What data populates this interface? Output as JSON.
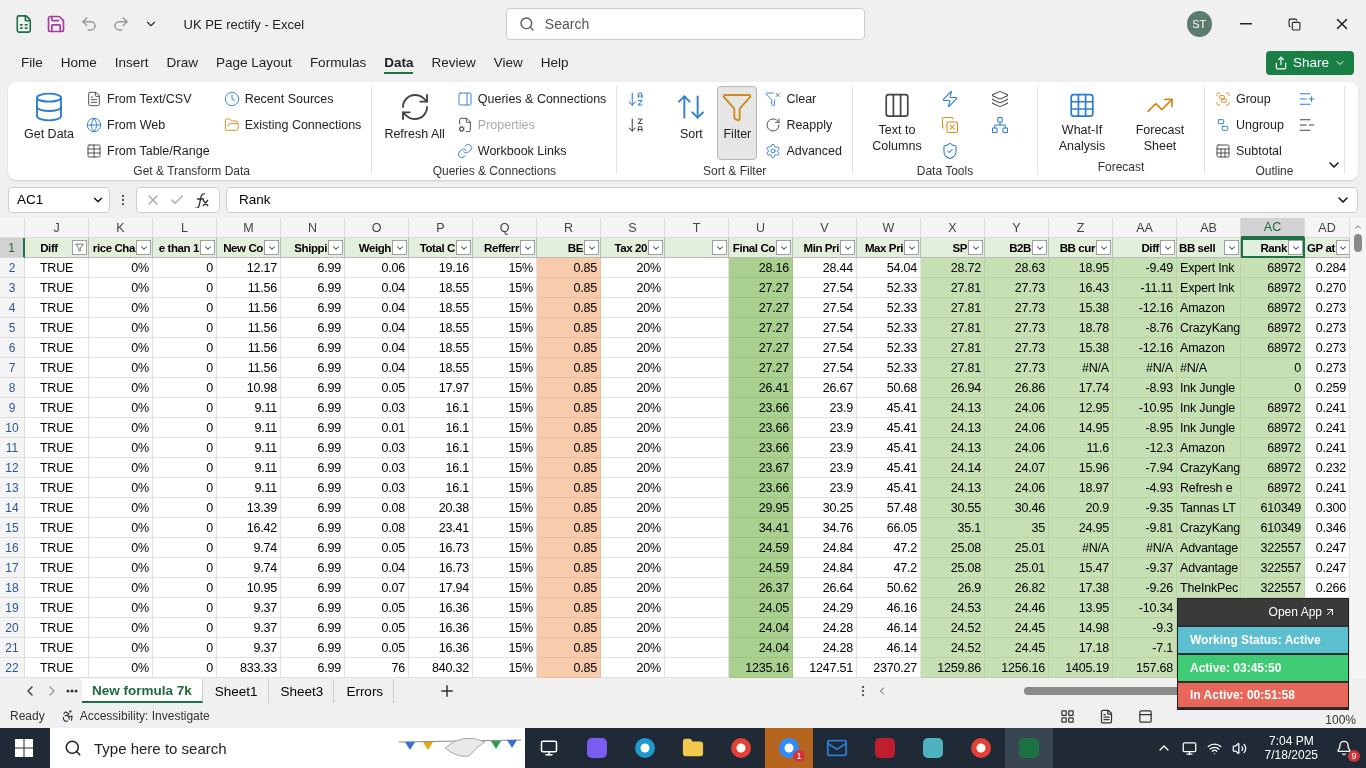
{
  "title_bar": {
    "title": "UK PE rectify  -  Excel",
    "search_placeholder": "Search",
    "avatar": "ST"
  },
  "menu_tabs": [
    {
      "label": "File",
      "selected": false
    },
    {
      "label": "Home",
      "selected": false
    },
    {
      "label": "Insert",
      "selected": false
    },
    {
      "label": "Draw",
      "selected": false
    },
    {
      "label": "Page Layout",
      "selected": false
    },
    {
      "label": "Formulas",
      "selected": false
    },
    {
      "label": "Data",
      "selected": true
    },
    {
      "label": "Review",
      "selected": false
    },
    {
      "label": "View",
      "selected": false
    },
    {
      "label": "Help",
      "selected": false
    }
  ],
  "share_button": "Share",
  "ribbon": [
    {
      "label": "Get & Transform Data",
      "items": [
        {
          "kind": "large",
          "label": "Get Data"
        },
        {
          "kind": "small",
          "label": "From Text/CSV"
        },
        {
          "kind": "small",
          "label": "From Web"
        },
        {
          "kind": "small",
          "label": "From Table/Range"
        },
        {
          "kind": "small",
          "label": "Recent Sources"
        },
        {
          "kind": "small",
          "label": "Existing Connections"
        }
      ]
    },
    {
      "label": "Queries & Connections",
      "items": [
        {
          "kind": "large",
          "label": "Refresh All"
        },
        {
          "kind": "small",
          "label": "Queries & Connections"
        },
        {
          "kind": "small",
          "label": "Properties",
          "disabled": true
        },
        {
          "kind": "small",
          "label": "Workbook Links"
        }
      ]
    },
    {
      "label": "Sort & Filter",
      "items": [
        {
          "kind": "icon"
        },
        {
          "kind": "icon"
        },
        {
          "kind": "large",
          "label": "Sort"
        },
        {
          "kind": "large",
          "label": "Filter",
          "pressed": true
        },
        {
          "kind": "small",
          "label": "Clear"
        },
        {
          "kind": "small",
          "label": "Reapply"
        },
        {
          "kind": "small",
          "label": "Advanced"
        }
      ]
    },
    {
      "label": "Data Tools",
      "items": [
        {
          "kind": "large",
          "label": "Text to Columns"
        },
        {
          "kind": "icon"
        },
        {
          "kind": "icon"
        },
        {
          "kind": "icon"
        },
        {
          "kind": "icon"
        },
        {
          "kind": "icon"
        }
      ]
    },
    {
      "label": "Forecast",
      "items": [
        {
          "kind": "large",
          "label": "What-If Analysis"
        },
        {
          "kind": "large",
          "label": "Forecast Sheet"
        }
      ]
    },
    {
      "label": "Outline",
      "items": [
        {
          "kind": "small",
          "label": "Group"
        },
        {
          "kind": "small",
          "label": "Ungroup"
        },
        {
          "kind": "small",
          "label": "Subtotal"
        },
        {
          "kind": "icon"
        },
        {
          "kind": "icon"
        }
      ]
    }
  ],
  "formula_bar": {
    "name_box": "AC1",
    "formula": "Rank"
  },
  "columns": [
    {
      "letter": "J",
      "header": "Diff",
      "kind": "bool",
      "filtered": true,
      "selected": false
    },
    {
      "letter": "K",
      "header": "rice Cha",
      "kind": "number",
      "filtered": false,
      "selected": false
    },
    {
      "letter": "L",
      "header": "e than 1",
      "kind": "number",
      "filtered": false,
      "selected": false
    },
    {
      "letter": "M",
      "header": "New Co",
      "kind": "number",
      "filtered": false,
      "selected": false
    },
    {
      "letter": "N",
      "header": "Shippi",
      "kind": "number",
      "filtered": false,
      "selected": false
    },
    {
      "letter": "O",
      "header": "Weigh",
      "kind": "number",
      "filtered": false,
      "selected": false
    },
    {
      "letter": "P",
      "header": "Total C",
      "kind": "number",
      "filtered": false,
      "selected": false
    },
    {
      "letter": "Q",
      "header": "Refferr",
      "kind": "number",
      "filtered": false,
      "selected": false
    },
    {
      "letter": "R",
      "header": "BE",
      "kind": "number",
      "filtered": false,
      "selected": false,
      "color": "#f8cbad"
    },
    {
      "letter": "S",
      "header": "Tax 20",
      "kind": "number",
      "filtered": false,
      "selected": false
    },
    {
      "letter": "T",
      "kind": "number",
      "filtered": false,
      "selected": false
    },
    {
      "letter": "U",
      "header": "Final Co",
      "kind": "number",
      "filtered": false,
      "selected": false,
      "color": "#a9d08e"
    },
    {
      "letter": "V",
      "header": "Min Pri",
      "kind": "number",
      "filtered": false,
      "selected": false
    },
    {
      "letter": "W",
      "header": "Max Pri",
      "kind": "number",
      "filtered": false,
      "selected": false
    },
    {
      "letter": "X",
      "header": "SP",
      "kind": "number",
      "filtered": false,
      "selected": false,
      "color": "#c6e0b4"
    },
    {
      "letter": "Y",
      "header": "B2B",
      "kind": "number",
      "filtered": false,
      "selected": false,
      "color": "#c6e0b4"
    },
    {
      "letter": "Z",
      "header": "BB cur",
      "kind": "number",
      "filtered": false,
      "selected": false,
      "color": "#c6e0b4"
    },
    {
      "letter": "AA",
      "header": "Diff",
      "kind": "number",
      "filtered": false,
      "selected": false,
      "color": "#c6e0b4"
    },
    {
      "letter": "AB",
      "header": "BB sell",
      "kind": "text",
      "filtered": false,
      "selected": false,
      "color": "#c6e0b4"
    },
    {
      "letter": "AC",
      "header": "Rank",
      "kind": "number",
      "filtered": false,
      "selected": true,
      "color": "#c6e0b4"
    },
    {
      "letter": "AD",
      "header": "GP at",
      "kind": "number",
      "filtered": false,
      "selected": false
    }
  ],
  "header_row": {
    "number": "1",
    "selected": true
  },
  "rows": [
    {
      "number": "2",
      "cells": [
        "TRUE",
        "0%",
        "0",
        "12.17",
        "6.99",
        "0.06",
        "19.16",
        "15%",
        "0.85",
        "20%",
        null,
        "28.16",
        "28.44",
        "54.04",
        "28.72",
        "28.63",
        "18.95",
        "-9.49",
        "Expert Ink",
        "68972",
        "0.284"
      ]
    },
    {
      "number": "3",
      "cells": [
        "TRUE",
        "0%",
        "0",
        "11.56",
        "6.99",
        "0.04",
        "18.55",
        "15%",
        "0.85",
        "20%",
        null,
        "27.27",
        "27.54",
        "52.33",
        "27.81",
        "27.73",
        "16.43",
        "-11.11",
        "Expert Ink",
        "68972",
        "0.270"
      ]
    },
    {
      "number": "4",
      "cells": [
        "TRUE",
        "0%",
        "0",
        "11.56",
        "6.99",
        "0.04",
        "18.55",
        "15%",
        "0.85",
        "20%",
        null,
        "27.27",
        "27.54",
        "52.33",
        "27.81",
        "27.73",
        "15.38",
        "-12.16",
        "Amazon",
        "68972",
        "0.273"
      ]
    },
    {
      "number": "5",
      "cells": [
        "TRUE",
        "0%",
        "0",
        "11.56",
        "6.99",
        "0.04",
        "18.55",
        "15%",
        "0.85",
        "20%",
        null,
        "27.27",
        "27.54",
        "52.33",
        "27.81",
        "27.73",
        "18.78",
        "-8.76",
        "CrazyKang",
        "68972",
        "0.273"
      ]
    },
    {
      "number": "6",
      "cells": [
        "TRUE",
        "0%",
        "0",
        "11.56",
        "6.99",
        "0.04",
        "18.55",
        "15%",
        "0.85",
        "20%",
        null,
        "27.27",
        "27.54",
        "52.33",
        "27.81",
        "27.73",
        "15.38",
        "-12.16",
        "Amazon",
        "68972",
        "0.273"
      ]
    },
    {
      "number": "7",
      "cells": [
        "TRUE",
        "0%",
        "0",
        "11.56",
        "6.99",
        "0.04",
        "18.55",
        "15%",
        "0.85",
        "20%",
        null,
        "27.27",
        "27.54",
        "52.33",
        "27.81",
        "27.73",
        "#N/A",
        "#N/A",
        "#N/A",
        "0",
        "0.273"
      ]
    },
    {
      "number": "8",
      "cells": [
        "TRUE",
        "0%",
        "0",
        "10.98",
        "6.99",
        "0.05",
        "17.97",
        "15%",
        "0.85",
        "20%",
        null,
        "26.41",
        "26.67",
        "50.68",
        "26.94",
        "26.86",
        "17.74",
        "-8.93",
        "Ink Jungle",
        "0",
        "0.259"
      ]
    },
    {
      "number": "9",
      "cells": [
        "TRUE",
        "0%",
        "0",
        "9.11",
        "6.99",
        "0.03",
        "16.1",
        "15%",
        "0.85",
        "20%",
        null,
        "23.66",
        "23.9",
        "45.41",
        "24.13",
        "24.06",
        "12.95",
        "-10.95",
        "Ink Jungle",
        "68972",
        "0.241"
      ]
    },
    {
      "number": "10",
      "cells": [
        "TRUE",
        "0%",
        "0",
        "9.11",
        "6.99",
        "0.01",
        "16.1",
        "15%",
        "0.85",
        "20%",
        null,
        "23.66",
        "23.9",
        "45.41",
        "24.13",
        "24.06",
        "14.95",
        "-8.95",
        "Ink Jungle",
        "68972",
        "0.241"
      ]
    },
    {
      "number": "11",
      "cells": [
        "TRUE",
        "0%",
        "0",
        "9.11",
        "6.99",
        "0.03",
        "16.1",
        "15%",
        "0.85",
        "20%",
        null,
        "23.66",
        "23.9",
        "45.41",
        "24.13",
        "24.06",
        "11.6",
        "-12.3",
        "Amazon",
        "68972",
        "0.241"
      ]
    },
    {
      "number": "12",
      "cells": [
        "TRUE",
        "0%",
        "0",
        "9.11",
        "6.99",
        "0.03",
        "16.1",
        "15%",
        "0.85",
        "20%",
        null,
        "23.67",
        "23.9",
        "45.41",
        "24.14",
        "24.07",
        "15.96",
        "-7.94",
        "CrazyKang",
        "68972",
        "0.232"
      ]
    },
    {
      "number": "13",
      "cells": [
        "TRUE",
        "0%",
        "0",
        "9.11",
        "6.99",
        "0.03",
        "16.1",
        "15%",
        "0.85",
        "20%",
        null,
        "23.66",
        "23.9",
        "45.41",
        "24.13",
        "24.06",
        "18.97",
        "-4.93",
        "Refresh e",
        "68972",
        "0.241"
      ]
    },
    {
      "number": "14",
      "cells": [
        "TRUE",
        "0%",
        "0",
        "13.39",
        "6.99",
        "0.08",
        "20.38",
        "15%",
        "0.85",
        "20%",
        null,
        "29.95",
        "30.25",
        "57.48",
        "30.55",
        "30.46",
        "20.9",
        "-9.35",
        "Tannas LT",
        "610349",
        "0.300"
      ]
    },
    {
      "number": "15",
      "cells": [
        "TRUE",
        "0%",
        "0",
        "16.42",
        "6.99",
        "0.08",
        "23.41",
        "15%",
        "0.85",
        "20%",
        null,
        "34.41",
        "34.76",
        "66.05",
        "35.1",
        "35",
        "24.95",
        "-9.81",
        "CrazyKang",
        "610349",
        "0.346"
      ]
    },
    {
      "number": "16",
      "cells": [
        "TRUE",
        "0%",
        "0",
        "9.74",
        "6.99",
        "0.05",
        "16.73",
        "15%",
        "0.85",
        "20%",
        null,
        "24.59",
        "24.84",
        "47.2",
        "25.08",
        "25.01",
        "#N/A",
        "#N/A",
        "Advantage",
        "322557",
        "0.247"
      ]
    },
    {
      "number": "17",
      "cells": [
        "TRUE",
        "0%",
        "0",
        "9.74",
        "6.99",
        "0.04",
        "16.73",
        "15%",
        "0.85",
        "20%",
        null,
        "24.59",
        "24.84",
        "47.2",
        "25.08",
        "25.01",
        "15.47",
        "-9.37",
        "Advantage",
        "322557",
        "0.247"
      ]
    },
    {
      "number": "18",
      "cells": [
        "TRUE",
        "0%",
        "0",
        "10.95",
        "6.99",
        "0.07",
        "17.94",
        "15%",
        "0.85",
        "20%",
        null,
        "26.37",
        "26.64",
        "50.62",
        "26.9",
        "26.82",
        "17.38",
        "-9.26",
        "TheInkPec",
        "322557",
        "0.266"
      ]
    },
    {
      "number": "19",
      "cells": [
        "TRUE",
        "0%",
        "0",
        "9.37",
        "6.99",
        "0.05",
        "16.36",
        "15%",
        "0.85",
        "20%",
        null,
        "24.05",
        "24.29",
        "46.16",
        "24.53",
        "24.46",
        "13.95",
        "-10.34"
      ]
    },
    {
      "number": "20",
      "cells": [
        "TRUE",
        "0%",
        "0",
        "9.37",
        "6.99",
        "0.05",
        "16.36",
        "15%",
        "0.85",
        "20%",
        null,
        "24.04",
        "24.28",
        "46.14",
        "24.52",
        "24.45",
        "14.98",
        "-9.3"
      ]
    },
    {
      "number": "21",
      "cells": [
        "TRUE",
        "0%",
        "0",
        "9.37",
        "6.99",
        "0.05",
        "16.36",
        "15%",
        "0.85",
        "20%",
        null,
        "24.04",
        "24.28",
        "46.14",
        "24.52",
        "24.45",
        "17.18",
        "-7.1"
      ]
    },
    {
      "number": "22",
      "cells": [
        "TRUE",
        "0%",
        "0",
        "833.33",
        "6.99",
        "76",
        "840.32",
        "15%",
        "0.85",
        "20%",
        null,
        "1235.16",
        "1247.51",
        "2370.27",
        "1259.86",
        "1256.16",
        "1405.19",
        "157.68"
      ]
    }
  ],
  "sheet_tabs": [
    {
      "label": "New formula 7k",
      "selected": true
    },
    {
      "label": "Sheet1",
      "selected": false
    },
    {
      "label": "Sheet3",
      "selected": false
    },
    {
      "label": "Errors",
      "selected": false
    }
  ],
  "status_bar": {
    "ready": "Ready",
    "accessibility": "Accessibility: Investigate",
    "zoom": "100%"
  },
  "tracker": {
    "open_app": "Open App",
    "working_status": "Working Status: Active",
    "active": "Active: 03:45:50",
    "inactive": "In Active: 00:51:58"
  },
  "taskbar": {
    "search_placeholder": "Type here to search",
    "zoom_badge": "1",
    "time": "7:04 PM",
    "date": "7/18/2025",
    "notifications": "9"
  }
}
